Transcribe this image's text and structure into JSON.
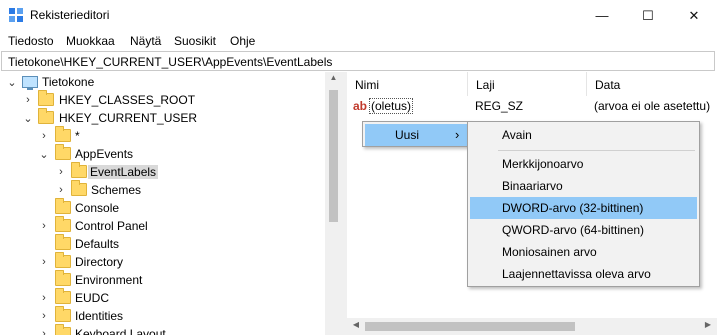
{
  "window": {
    "title": "Rekisterieditori",
    "icon": "registry-editor-icon",
    "minimize": "—",
    "maximize": "☐",
    "close": "✕"
  },
  "menu": [
    "Tiedosto",
    "Muokkaa",
    "Näytä",
    "Suosikit",
    "Ohje"
  ],
  "address": "Tietokone\\HKEY_CURRENT_USER\\AppEvents\\EventLabels",
  "tree": [
    {
      "label": "Tietokone",
      "chev": "⌄"
    },
    {
      "label": "HKEY_CLASSES_ROOT",
      "chev": "›"
    },
    {
      "label": "HKEY_CURRENT_USER",
      "chev": "⌄"
    },
    {
      "label": "*",
      "chev": "›"
    },
    {
      "label": "AppEvents",
      "chev": "⌄"
    },
    {
      "label": "EventLabels",
      "chev": "›"
    },
    {
      "label": "Schemes",
      "chev": "›"
    },
    {
      "label": "Console",
      "chev": ""
    },
    {
      "label": "Control Panel",
      "chev": "›"
    },
    {
      "label": "Defaults",
      "chev": ""
    },
    {
      "label": "Directory",
      "chev": "›"
    },
    {
      "label": "Environment",
      "chev": ""
    },
    {
      "label": "EUDC",
      "chev": "›"
    },
    {
      "label": "Identities",
      "chev": "›"
    },
    {
      "label": "Keyboard Layout",
      "chev": "›"
    }
  ],
  "columns": [
    "Nimi",
    "Laji",
    "Data"
  ],
  "values": [
    {
      "name": "(oletus)",
      "type": "REG_SZ",
      "data": "(arvoa ei ole asetettu)",
      "icon": "ab"
    }
  ],
  "context_menu": {
    "item": "Uusi",
    "arrow": "›"
  },
  "submenu": {
    "items": [
      "Avain",
      "Merkkijonoarvo",
      "Binaariarvo",
      "DWORD-arvo (32-bittinen)",
      "QWORD-arvo (64-bittinen)",
      "Moniosainen arvo",
      "Laajennettavissa oleva arvo"
    ],
    "highlighted": "DWORD-arvo (32-bittinen)"
  },
  "colors": {
    "highlight": "#91c9f7",
    "folder": "#ffd867"
  }
}
